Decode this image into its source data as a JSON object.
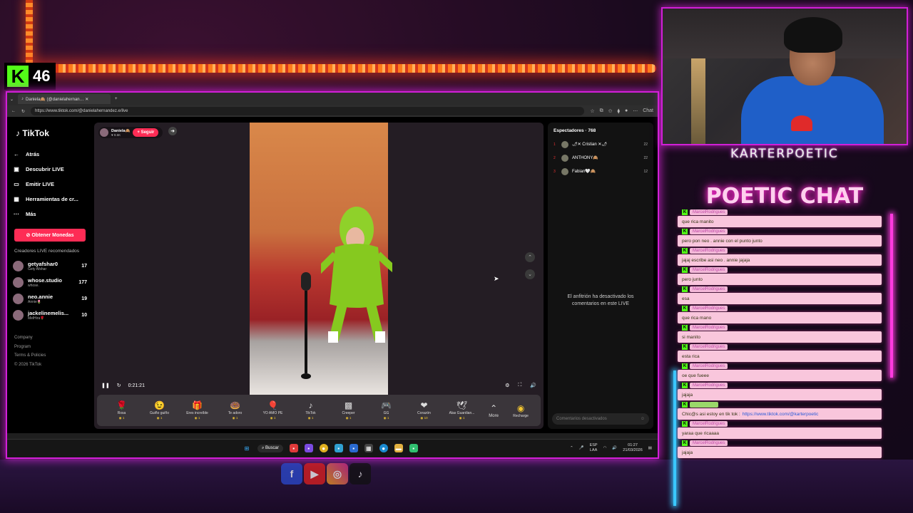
{
  "overlay": {
    "kick_count": "46",
    "brand": "KARTERPOETIC",
    "chat_title": "POETIC CHAT"
  },
  "browser": {
    "tab_title": "Daniela🙈 (@danielahernan… ✕",
    "url": "https://www.tiktok.com/@danielahernandez.e/live",
    "chat_label": "Chat"
  },
  "tiktok": {
    "logo": "TikTok",
    "back": "Atrás",
    "nav": [
      {
        "icon": "compass-icon",
        "glyph": "▣",
        "label": "Descubrir LIVE"
      },
      {
        "icon": "video-icon",
        "glyph": "▭",
        "label": "Emitir LIVE"
      },
      {
        "icon": "toolbox-icon",
        "glyph": "▦",
        "label": "Herramientas de cr..."
      },
      {
        "icon": "more-dots-icon",
        "glyph": "···",
        "label": "Más"
      }
    ],
    "coins_button": "Obtener Monedas",
    "recommended_title": "Creadores LIVE recomendados",
    "recommended": [
      {
        "name": "getyafshar0",
        "sub": "Gety Afshar",
        "count": "17"
      },
      {
        "name": "whose.studio",
        "sub": "whose.",
        "count": "177"
      },
      {
        "name": "neo.annie",
        "sub": "Annie🌷",
        "count": "19"
      },
      {
        "name": "jackelinemelis...",
        "sub": "MelHira🌹",
        "count": "10"
      }
    ],
    "footer": [
      "Company",
      "Program",
      "Terms & Policies",
      "© 2026 TikTok"
    ],
    "host": {
      "name": "Daniela🙈",
      "likes": "♥ 9.6K",
      "follow": "+ Seguir"
    },
    "time": "0:21:21",
    "gifts": [
      {
        "name": "Rosa",
        "glyph": "🌹",
        "price": "1"
      },
      {
        "name": "Guiño guiño",
        "glyph": "😉",
        "price": "1"
      },
      {
        "name": "Eres increíble",
        "glyph": "🎁",
        "price": "1"
      },
      {
        "name": "Te adoro",
        "glyph": "🍩",
        "price": "1"
      },
      {
        "name": "YO AMO PE",
        "glyph": "🎈",
        "price": "1"
      },
      {
        "name": "TikTok",
        "glyph": "♪",
        "price": "1"
      },
      {
        "name": "Creeper",
        "glyph": "▩",
        "price": "1"
      },
      {
        "name": "GG",
        "glyph": "🎮",
        "price": "1"
      },
      {
        "name": "Corazón",
        "glyph": "❤",
        "price": "10"
      },
      {
        "name": "Alas Guardian...",
        "glyph": "🕊",
        "price": "1"
      }
    ],
    "more": "More",
    "recharge": "Recharge",
    "viewers_title": "Espectadores · 768",
    "viewers": [
      {
        "rank": "1",
        "name": "🌶✕ Cristian ✕🌶",
        "count": "22"
      },
      {
        "rank": "2",
        "name": "ANTHONY🙈",
        "count": "22"
      },
      {
        "rank": "3",
        "name": "Fabian🤍🙈",
        "count": "12"
      }
    ],
    "comments_disabled": "El anfitrión ha desactivado los comentarios en este LIVE",
    "comment_placeholder": "Comentarios desactivados"
  },
  "taskbar": {
    "search": "Buscar",
    "lang": "ESP",
    "region": "LAA",
    "time": "01:27",
    "date": "21/03/2026"
  },
  "chat": [
    {
      "user": "MarcelRodrigues",
      "text": "que rica manito"
    },
    {
      "user": "MarcelRodrigues",
      "text": "pero pon neo . annie con el punto junto"
    },
    {
      "user": "MarcelRodrigues",
      "text": "jajaj escribe asi neo . annie jajaja"
    },
    {
      "user": "MarcelRodrigues",
      "text": "pero junto"
    },
    {
      "user": "MarcelRodrigues",
      "text": "esa"
    },
    {
      "user": "MarcelRodrigues",
      "text": "que rica mano"
    },
    {
      "user": "MarcelRodrigues",
      "text": "si manito"
    },
    {
      "user": "MarcelRodrigues",
      "text": "esta rica"
    },
    {
      "user": "MarcelRodrigues",
      "text": "oe que fueee"
    },
    {
      "user": "MarcelRodrigues",
      "text": "jajaja"
    },
    {
      "user": "",
      "text": "Chic@s asi estoy en tik tok : ",
      "link": "https://www.tiktok.com/@karterpoetic"
    },
    {
      "user": "MarcelRodrigues",
      "text": "yaraa que ricaaaa"
    },
    {
      "user": "MarcelRodrigues",
      "text": "jajaja"
    }
  ],
  "colors": {
    "tiktok_red": "#fe2c55",
    "kick_green": "#53fc18",
    "neon_magenta": "#d21fd8",
    "chat_pink": "#f9c6dc"
  }
}
